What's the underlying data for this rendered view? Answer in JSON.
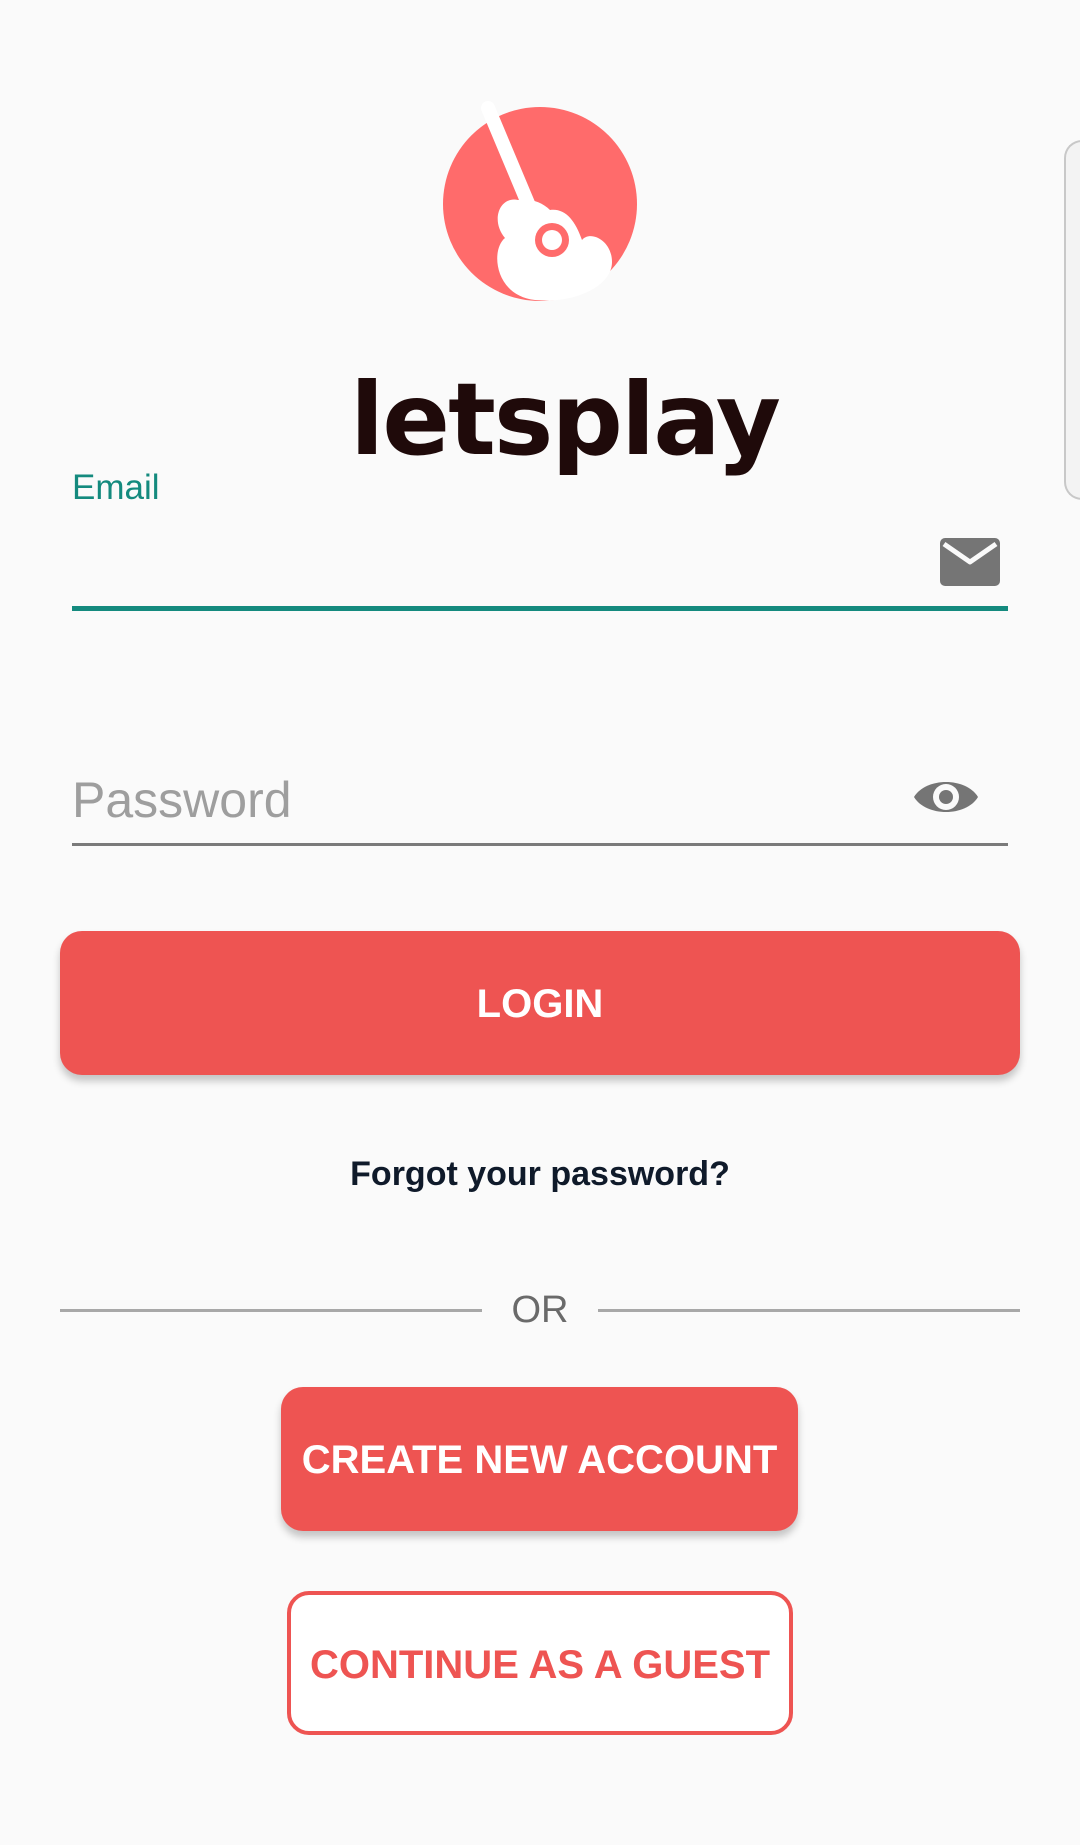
{
  "app": {
    "logo_text": "letsplay"
  },
  "form": {
    "email": {
      "label": "Email",
      "value": "",
      "icon": "mail-icon"
    },
    "password": {
      "placeholder": "Password",
      "value": "",
      "icon": "eye-icon"
    }
  },
  "actions": {
    "login_label": "LOGIN",
    "forgot_label": "Forgot your password?",
    "divider_label": "OR",
    "create_label": "CREATE NEW ACCOUNT",
    "guest_label": "CONTINUE AS A GUEST"
  },
  "colors": {
    "accent": "#ee5452",
    "logo_circle": "#ff6b6b",
    "field_focus": "#148a7e",
    "background": "#fafafa"
  }
}
